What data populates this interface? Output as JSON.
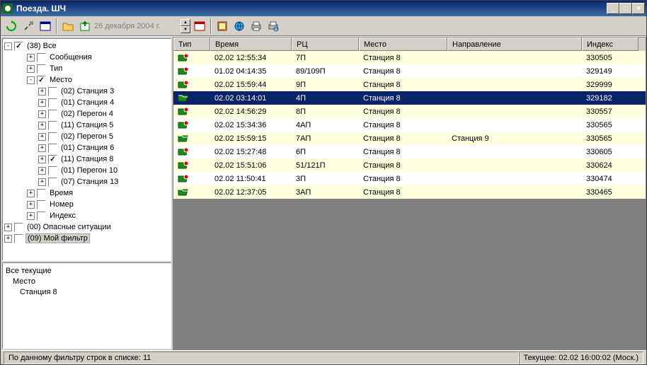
{
  "window": {
    "title": "Поезда. ШЧ"
  },
  "toolbar": {
    "date": "26 декабря 2004 г."
  },
  "tree": {
    "root": {
      "label": "(38) Все",
      "checked": true,
      "exp": "-"
    },
    "items": [
      {
        "level": 1,
        "exp": "+",
        "checked": false,
        "label": "Сообщения"
      },
      {
        "level": 1,
        "exp": "+",
        "checked": false,
        "label": "Тип"
      },
      {
        "level": 1,
        "exp": "-",
        "checked": true,
        "label": "Место"
      },
      {
        "level": 2,
        "exp": "+",
        "checked": false,
        "label": "(02) Станция 3"
      },
      {
        "level": 2,
        "exp": "+",
        "checked": false,
        "label": "(01) Станция 4"
      },
      {
        "level": 2,
        "exp": "+",
        "checked": false,
        "label": "(02) Перегон 4"
      },
      {
        "level": 2,
        "exp": "+",
        "checked": false,
        "label": "(11) Станция 5"
      },
      {
        "level": 2,
        "exp": "+",
        "checked": false,
        "label": "(02) Перегон 5"
      },
      {
        "level": 2,
        "exp": "+",
        "checked": false,
        "label": "(01) Станция 6"
      },
      {
        "level": 2,
        "exp": "+",
        "checked": true,
        "label": "(11) Станция 8"
      },
      {
        "level": 2,
        "exp": "+",
        "checked": false,
        "label": "(01) Перегон 10"
      },
      {
        "level": 2,
        "exp": "+",
        "checked": false,
        "label": "(07) Станция 13"
      },
      {
        "level": 1,
        "exp": "+",
        "checked": false,
        "label": "Время"
      },
      {
        "level": 1,
        "exp": "+",
        "checked": false,
        "label": "Номер"
      },
      {
        "level": 1,
        "exp": "+",
        "checked": false,
        "label": "Индекс"
      },
      {
        "level": 0,
        "exp": "+",
        "checked": false,
        "label": "(00) Опасные ситуации",
        "root": true
      },
      {
        "level": 0,
        "exp": "+",
        "checked": false,
        "label": "(09) Мой фильтр",
        "root": true,
        "sel": true
      }
    ]
  },
  "summary": {
    "line1": "Все текущие",
    "line2": "Место",
    "line3": "Станция 8"
  },
  "grid": {
    "cols": [
      "Тип",
      "Время",
      "РЦ",
      "Место",
      "Направление",
      "Индекс"
    ],
    "rows": [
      {
        "icon": "red",
        "time": "02.02 12:55:34",
        "rc": "7П",
        "place": "Станция 8",
        "dir": "",
        "idx": "330505"
      },
      {
        "icon": "red",
        "time": "01.02 04:14:35",
        "rc": "89/109П",
        "place": "Станция 8",
        "dir": "",
        "idx": "329149"
      },
      {
        "icon": "red",
        "time": "02.02 15:59:44",
        "rc": "9П",
        "place": "Станция 8",
        "dir": "",
        "idx": "329999"
      },
      {
        "icon": "grn",
        "time": "02.02 03:14:01",
        "rc": "4П",
        "place": "Станция 8",
        "dir": "",
        "idx": "329182",
        "sel": true
      },
      {
        "icon": "red",
        "time": "02.02 14:56:29",
        "rc": "8П",
        "place": "Станция 8",
        "dir": "",
        "idx": "330557"
      },
      {
        "icon": "red",
        "time": "02.02 15:34:36",
        "rc": "4АП",
        "place": "Станция 8",
        "dir": "",
        "idx": "330565"
      },
      {
        "icon": "grn",
        "time": "02.02 15:59:15",
        "rc": "7АП",
        "place": "Станция 8",
        "dir": "Станция 9",
        "idx": "330565"
      },
      {
        "icon": "red",
        "time": "02.02 15:27:48",
        "rc": "6П",
        "place": "Станция 8",
        "dir": "",
        "idx": "330605"
      },
      {
        "icon": "red",
        "time": "02.02 15:51:06",
        "rc": "51/121П",
        "place": "Станция 8",
        "dir": "",
        "idx": "330624"
      },
      {
        "icon": "red",
        "time": "02.02 11:50:41",
        "rc": "3П",
        "place": "Станция 8",
        "dir": "",
        "idx": "330474"
      },
      {
        "icon": "grn",
        "time": "02.02 12:37:05",
        "rc": "3АП",
        "place": "Станция 8",
        "dir": "",
        "idx": "330465"
      }
    ]
  },
  "status": {
    "left": "По данному фильтру строк в списке:  11",
    "right": "Текущее: 02.02 16:00:02 (Моск.)"
  }
}
